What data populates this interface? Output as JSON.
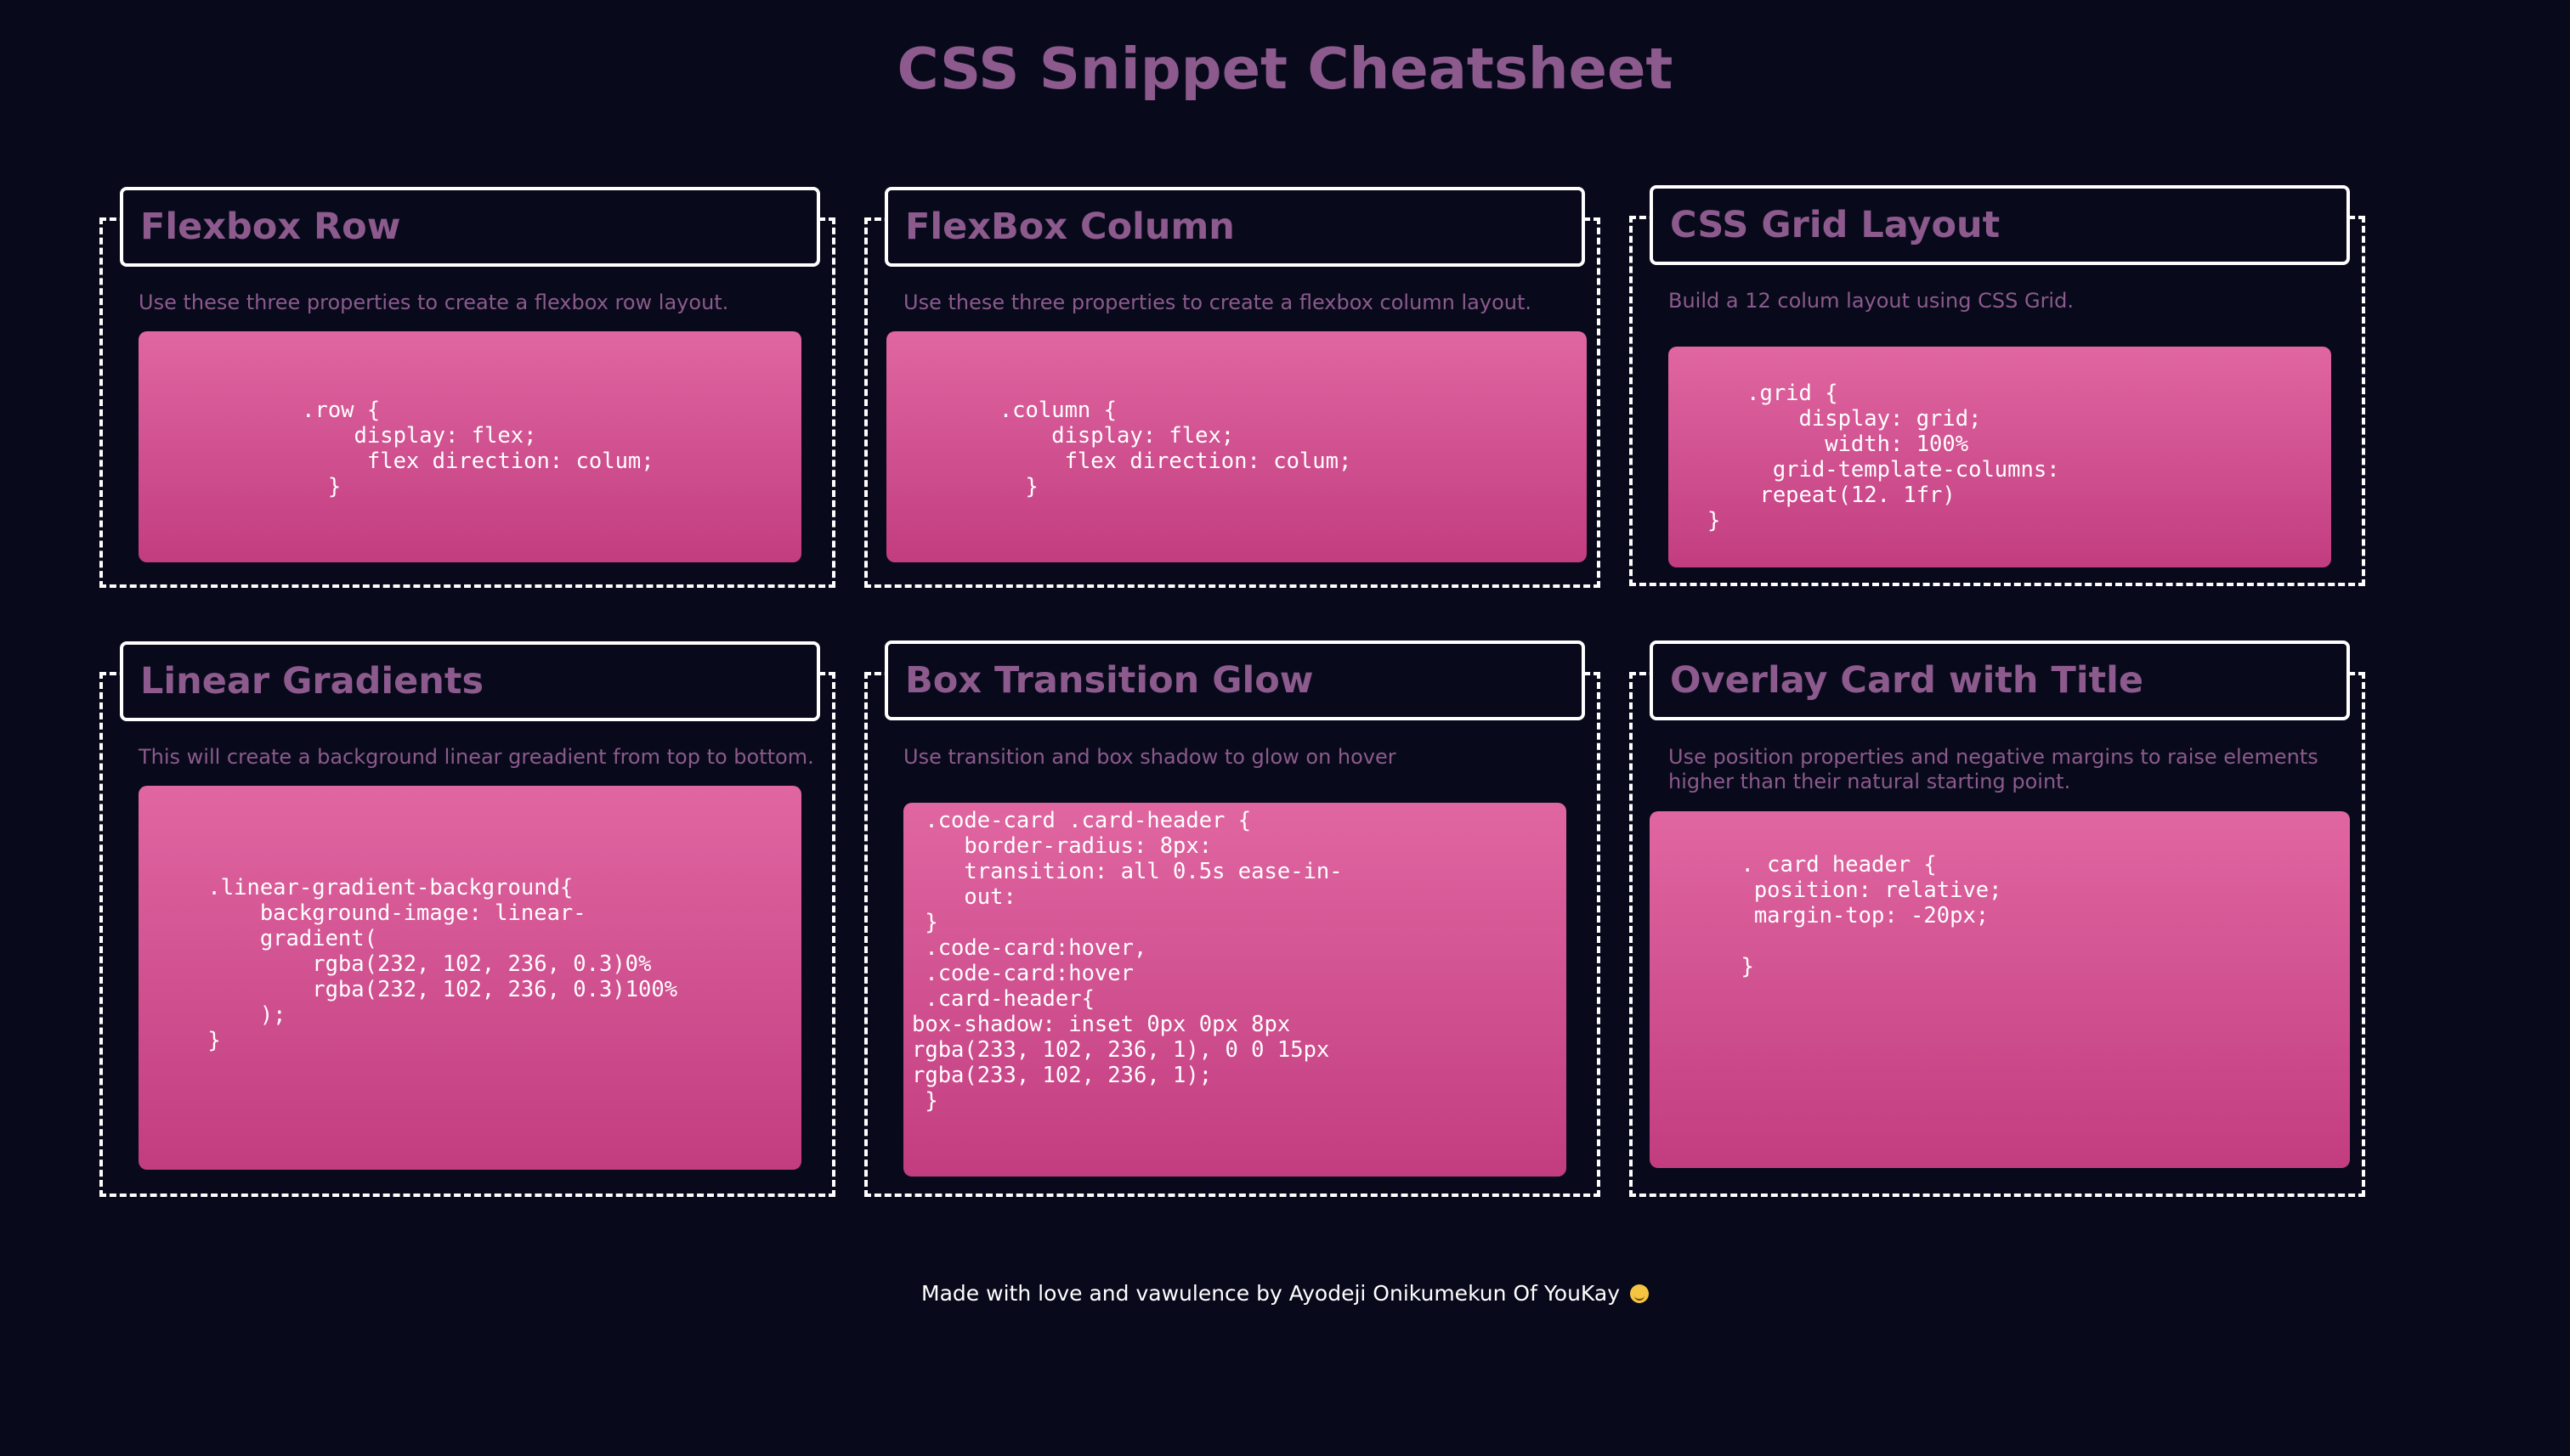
{
  "page": {
    "title": "CSS Snippet Cheatsheet"
  },
  "colors": {
    "background": "#080a1c",
    "title_text": "#8c5a8c",
    "card_border": "#ffffff",
    "code_gradient_top": "#e066a1",
    "code_gradient_bottom": "#c23d80",
    "code_text": "#ffffff"
  },
  "cards": [
    {
      "title": "Flexbox Row",
      "description": "Use these three properties to create a flexbox row layout.",
      "code": "      .row {\n          display: flex;\n           flex direction: colum;\n        }"
    },
    {
      "title": "FlexBox Column",
      "description": "Use these three properties to create a flexbox column layout.",
      "code": "        .column {\n            display: flex;\n             flex direction: colum;\n          }"
    },
    {
      "title": "CSS Grid Layout",
      "description": "Build a 12 colum layout using CSS Grid.",
      "code": "      .grid {\n          display: grid;\n            width: 100%\n        grid-template-columns:\n       repeat(12. 1fr)\n   }"
    },
    {
      "title": "Linear Gradients",
      "description": "This will create a background linear greadient from top to bottom.",
      "code": "    .linear-gradient-background{\n        background-image: linear-\n        gradient(\n            rgba(232, 102, 236, 0.3)0%\n            rgba(232, 102, 236, 0.3)100%\n        );\n    }"
    },
    {
      "title": "Box Transition Glow",
      "description": "Use transition and box shadow to glow on hover",
      "code": " .code-card .card-header {\n    border-radius: 8px:\n    transition: all 0.5s ease-in-\n    out:\n }\n .code-card:hover,\n .code-card:hover\n .card-header{\nbox-shadow: inset 0px 0px 8px\nrgba(233, 102, 236, 1), 0 0 15px\nrgba(233, 102, 236, 1);\n }"
    },
    {
      "title": "Overlay Card with Title",
      "description": "Use position properties and negative margins to raise elements higher than their natural starting point.",
      "code": "       . card header {\n        position: relative;\n        margin-top: -20px;\n\n       }"
    }
  ],
  "footer": {
    "text": "Made with love and vawulence by Ayodeji Onikumekun Of YouKay",
    "emoji_icon": "grinning-face-icon"
  }
}
